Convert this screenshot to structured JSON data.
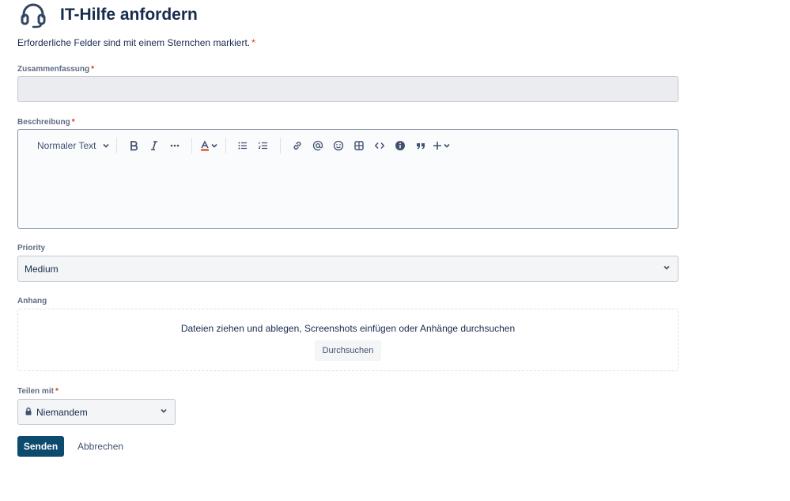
{
  "header": {
    "icon": "headset-icon",
    "title": "IT-Hilfe anfordern"
  },
  "required_note": {
    "text": "Erforderliche Felder sind mit einem Sternchen markiert.",
    "asterisk": "*"
  },
  "summary": {
    "label": "Zusammenfassung",
    "asterisk": "*",
    "value": ""
  },
  "description": {
    "label": "Beschreibung",
    "asterisk": "*",
    "toolbar": {
      "text_style": "Normaler Text",
      "icons": [
        "bold-icon",
        "italic-icon",
        "more-formatting-icon",
        "text-color-icon",
        "bullet-list-icon",
        "numbered-list-icon",
        "link-icon",
        "mention-icon",
        "emoji-icon",
        "table-icon",
        "code-icon",
        "info-panel-icon",
        "quote-icon",
        "insert-plus-icon"
      ]
    },
    "value": ""
  },
  "priority": {
    "label": "Priority",
    "value": "Medium"
  },
  "attachment": {
    "label": "Anhang",
    "drop_text": "Dateien ziehen und ablegen, Screenshots einfügen oder Anhänge durchsuchen",
    "browse_label": "Durchsuchen"
  },
  "share": {
    "label": "Teilen mit",
    "asterisk": "*",
    "value": "Niemandem"
  },
  "actions": {
    "submit_label": "Senden",
    "cancel_label": "Abbrechen"
  },
  "colors": {
    "primary": "#0c4a6e",
    "required": "#de350b",
    "text": "#172b4d",
    "muted": "#5e6c84"
  }
}
